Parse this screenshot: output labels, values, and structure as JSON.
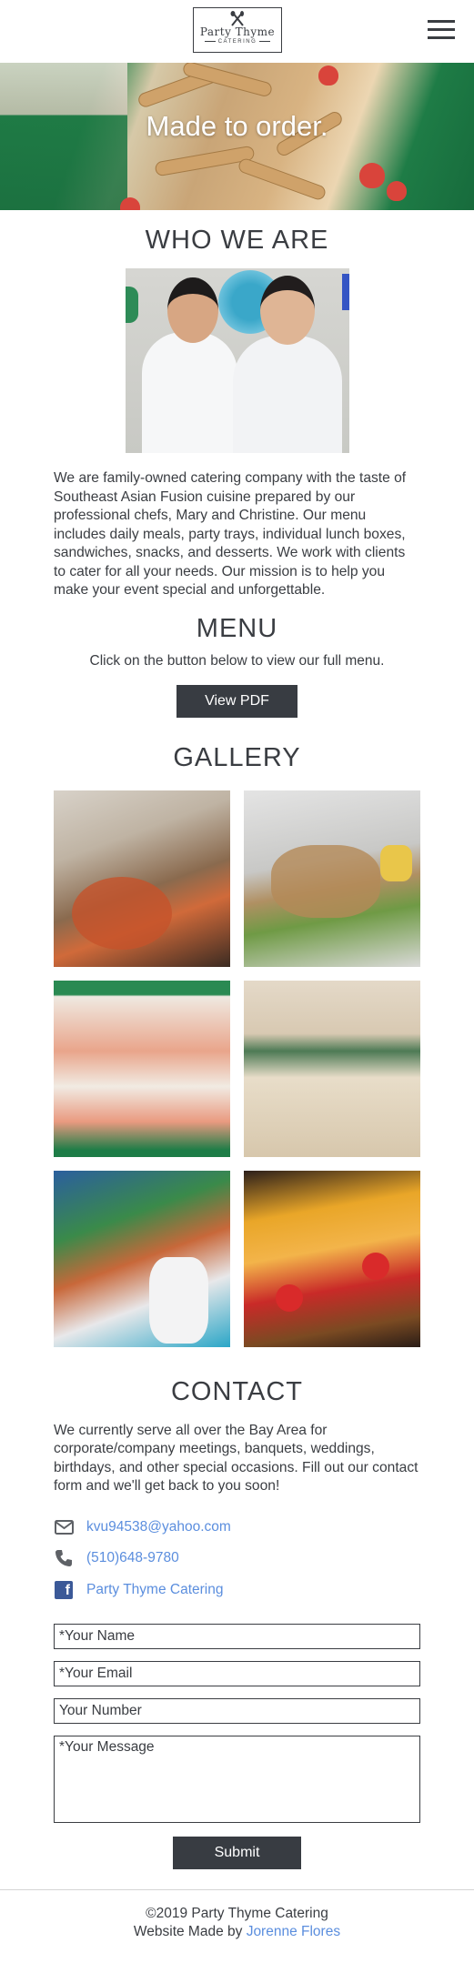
{
  "header": {
    "logo_name": "Party Thyme",
    "logo_sub": "CATERING"
  },
  "hero": {
    "title": "Made to order."
  },
  "who": {
    "title": "WHO WE ARE",
    "body": "We are family-owned catering company with the taste of Southeast Asian Fusion cuisine prepared by our professional chefs, Mary and Christine. Our menu includes daily meals, party trays, individual lunch boxes, sandwiches, snacks, and desserts. We work with clients to cater for all your needs. Our mission is to help you make your event special and unforgettable."
  },
  "menu": {
    "title": "MENU",
    "text": "Click on the button below to view our full menu.",
    "button": "View PDF"
  },
  "gallery": {
    "title": "GALLERY"
  },
  "contact": {
    "title": "CONTACT",
    "body": "We currently serve all over the Bay Area for corporate/company meetings, banquets, weddings, birthdays, and other special occasions. Fill out our contact form and we'll get back to you soon!",
    "email": "kvu94538@yahoo.com",
    "phone": "(510)648-9780",
    "facebook": "Party Thyme Catering"
  },
  "form": {
    "name_placeholder": "*Your Name",
    "email_placeholder": "*Your Email",
    "number_placeholder": "Your Number",
    "message_placeholder": "*Your Message",
    "submit": "Submit"
  },
  "footer": {
    "copyright": "©2019 Party Thyme Catering",
    "made_by": "Website Made by ",
    "author": "Jorenne Flores"
  },
  "colors": {
    "text": "#3a3d42",
    "button": "#383c42",
    "link": "#5b8ede",
    "facebook": "#3b5998"
  }
}
